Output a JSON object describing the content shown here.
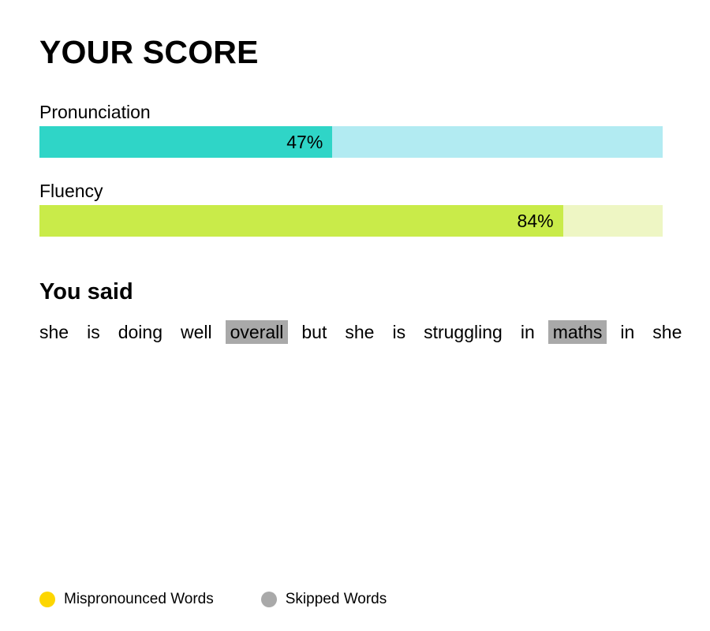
{
  "page": {
    "title": "YOUR SCORE"
  },
  "scores": [
    {
      "label": "Pronunciation",
      "value_text": "47%",
      "value": 0.47,
      "fill_color": "#2fd5c7",
      "track_color": "#b2ebf2"
    },
    {
      "label": "Fluency",
      "value_text": "84%",
      "value": 0.84,
      "fill_color": "#c9eb49",
      "track_color": "#eef6c4"
    }
  ],
  "transcript": {
    "heading": "You said",
    "words": [
      {
        "text": "she",
        "status": "ok"
      },
      {
        "text": "is",
        "status": "ok"
      },
      {
        "text": "doing",
        "status": "ok"
      },
      {
        "text": "well",
        "status": "ok"
      },
      {
        "text": "overall",
        "status": "skipped"
      },
      {
        "text": "but",
        "status": "ok"
      },
      {
        "text": "she",
        "status": "ok"
      },
      {
        "text": "is",
        "status": "ok"
      },
      {
        "text": "struggling",
        "status": "ok"
      },
      {
        "text": "in",
        "status": "ok"
      },
      {
        "text": "maths",
        "status": "skipped"
      },
      {
        "text": "in",
        "status": "ok"
      },
      {
        "text": "she",
        "status": "ok"
      }
    ]
  },
  "legend": [
    {
      "label": "Mispronounced Words",
      "color": "#fdd600",
      "icon": "yellow-dot-icon"
    },
    {
      "label": "Skipped Words",
      "color": "#a9a9a9",
      "icon": "gray-dot-icon"
    }
  ]
}
